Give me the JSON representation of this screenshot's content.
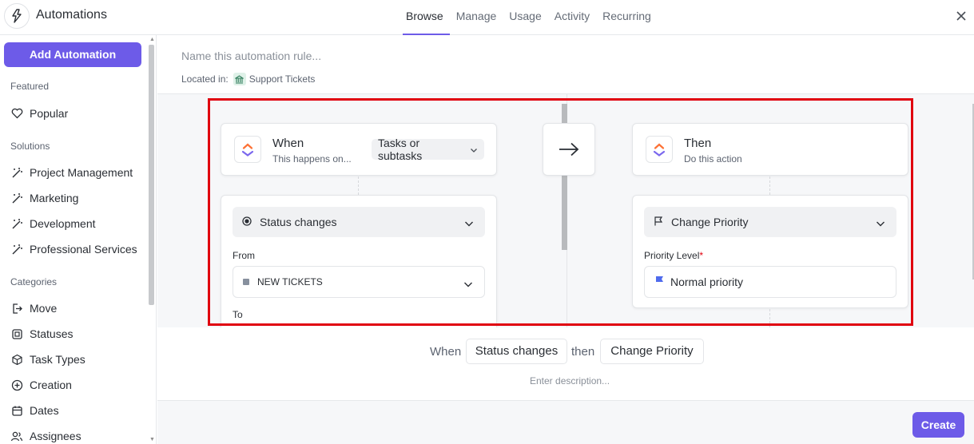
{
  "app": {
    "title": "Automations",
    "logo_icon": "clickup-automation-icon"
  },
  "tabs": [
    {
      "label": "Browse",
      "active": true
    },
    {
      "label": "Manage",
      "active": false
    },
    {
      "label": "Usage",
      "active": false
    },
    {
      "label": "Activity",
      "active": false
    },
    {
      "label": "Recurring",
      "active": false
    }
  ],
  "sidebar": {
    "add_button": "Add Automation",
    "featured_title": "Featured",
    "featured": [
      {
        "label": "Popular",
        "icon": "heart-icon"
      }
    ],
    "solutions_title": "Solutions",
    "solutions": [
      {
        "label": "Project Management",
        "icon": "wand-icon"
      },
      {
        "label": "Marketing",
        "icon": "wand-icon"
      },
      {
        "label": "Development",
        "icon": "wand-icon"
      },
      {
        "label": "Professional Services",
        "icon": "wand-icon"
      }
    ],
    "categories_title": "Categories",
    "categories": [
      {
        "label": "Move",
        "icon": "move-icon"
      },
      {
        "label": "Statuses",
        "icon": "status-square-icon"
      },
      {
        "label": "Task Types",
        "icon": "cube-icon"
      },
      {
        "label": "Creation",
        "icon": "plus-circle-icon"
      },
      {
        "label": "Dates",
        "icon": "calendar-icon"
      },
      {
        "label": "Assignees",
        "icon": "users-icon"
      }
    ]
  },
  "header": {
    "name_placeholder": "Name this automation rule...",
    "located_label": "Located in:",
    "location": "Support Tickets"
  },
  "trigger": {
    "title": "When",
    "subtitle": "This happens on...",
    "scope": "Tasks or subtasks",
    "event": "Status changes",
    "from_label": "From",
    "from_value": "NEW TICKETS",
    "to_label": "To"
  },
  "action": {
    "title": "Then",
    "subtitle": "Do this action",
    "action": "Change Priority",
    "priority_label": "Priority Level",
    "required_mark": "*",
    "priority_value": "Normal priority"
  },
  "summary": {
    "when": "When",
    "trigger_chip": "Status changes",
    "then": "then",
    "action_chip": "Change Priority",
    "description_placeholder": "Enter description..."
  },
  "footer": {
    "create_button": "Create"
  },
  "colors": {
    "accent": "#6d5be8",
    "highlight": "#e0000f",
    "priority_flag": "#4f6bed"
  }
}
